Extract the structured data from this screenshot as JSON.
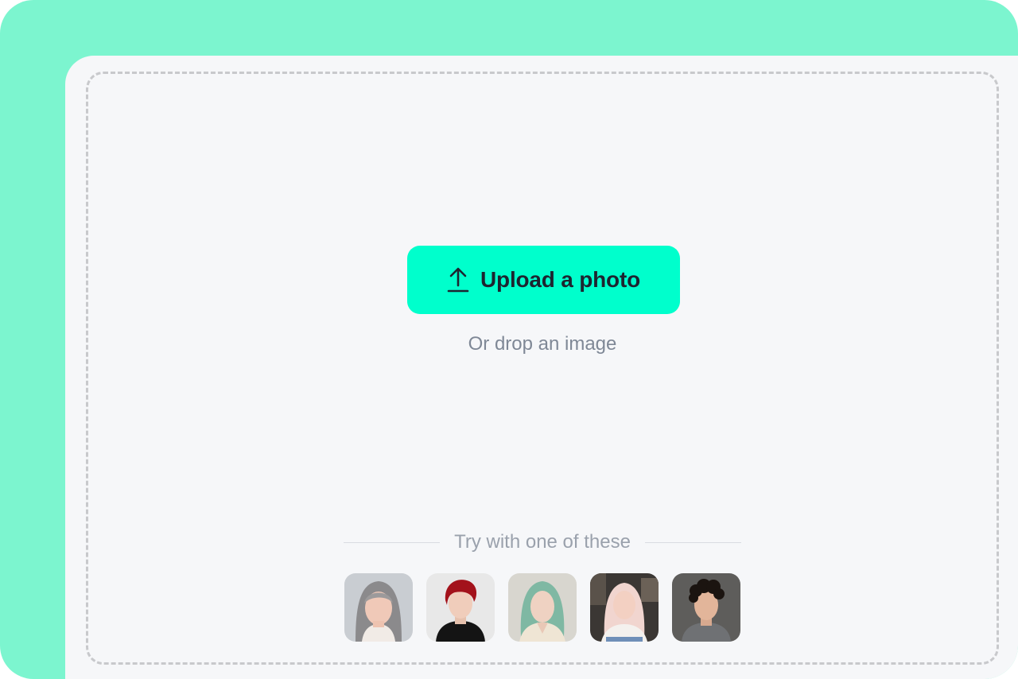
{
  "upload": {
    "button_label": "Upload a photo",
    "icon": "upload-arrow-icon",
    "hint": "Or drop an image"
  },
  "samples": {
    "title": "Try with one of these",
    "thumbnails": [
      {
        "name": "sample-photo-1",
        "description_icon": "portrait-gray-hair"
      },
      {
        "name": "sample-photo-2",
        "description_icon": "portrait-red-hair"
      },
      {
        "name": "sample-photo-3",
        "description_icon": "portrait-green-hair"
      },
      {
        "name": "sample-photo-4",
        "description_icon": "portrait-blonde-hair"
      },
      {
        "name": "sample-photo-5",
        "description_icon": "portrait-dark-curly-hair"
      }
    ]
  },
  "colors": {
    "frame": "#7cf5cf",
    "panel": "#f6f7f9",
    "accent": "#00ffcc",
    "button_text": "#1d2530"
  }
}
